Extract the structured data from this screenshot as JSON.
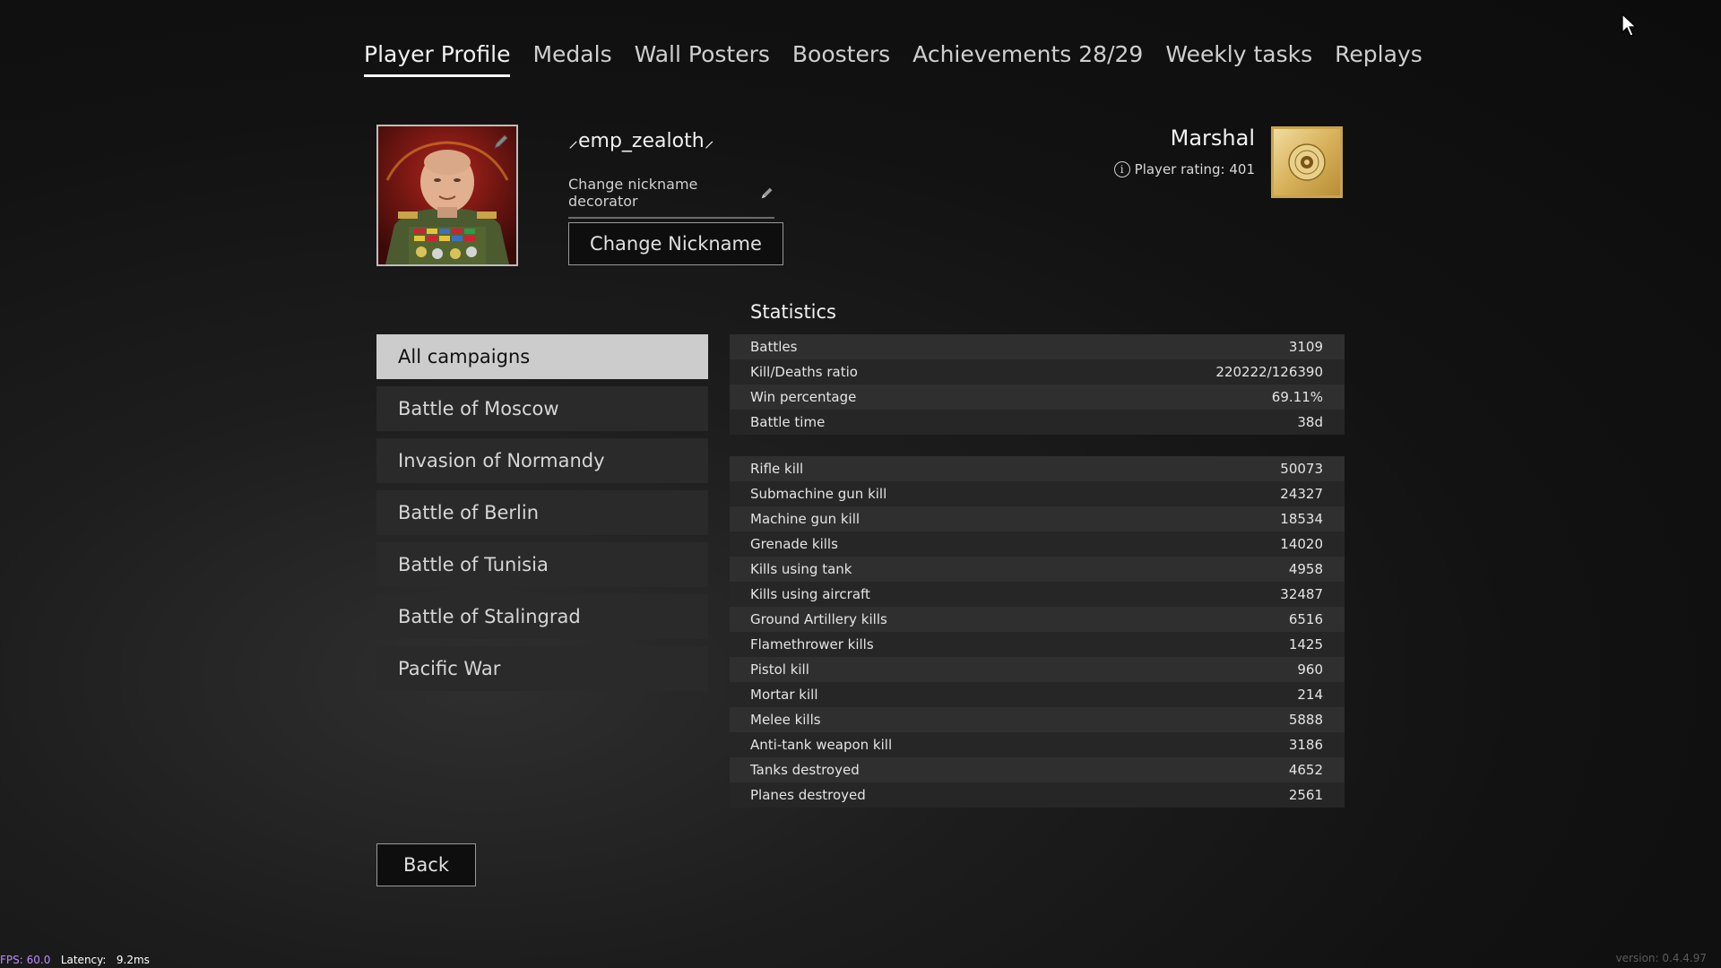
{
  "tabs": [
    {
      "label": "Player Profile",
      "active": true
    },
    {
      "label": "Medals"
    },
    {
      "label": "Wall Posters"
    },
    {
      "label": "Boosters"
    },
    {
      "label": "Achievements 28/29"
    },
    {
      "label": "Weekly tasks"
    },
    {
      "label": "Replays"
    }
  ],
  "profile": {
    "nickname": "⸝emp_zealoth⸝",
    "decorator_label": "Change nickname decorator",
    "change_nickname_label": "Change Nickname",
    "rank": "Marshal",
    "rating_label": "Player rating: 401"
  },
  "campaigns": [
    {
      "label": "All campaigns",
      "active": true
    },
    {
      "label": "Battle of Moscow"
    },
    {
      "label": "Invasion of Normandy"
    },
    {
      "label": "Battle of Berlin"
    },
    {
      "label": "Battle of Tunisia"
    },
    {
      "label": "Battle of Stalingrad"
    },
    {
      "label": "Pacific War"
    }
  ],
  "statistics": {
    "title": "Statistics",
    "general": [
      {
        "label": "Battles",
        "value": "3109"
      },
      {
        "label": "Kill/Deaths ratio",
        "value": "220222/126390"
      },
      {
        "label": "Win percentage",
        "value": "69.11%"
      },
      {
        "label": "Battle time",
        "value": "38d"
      }
    ],
    "kills": [
      {
        "label": "Rifle kill",
        "value": "50073"
      },
      {
        "label": "Submachine gun kill",
        "value": "24327"
      },
      {
        "label": "Machine gun kill",
        "value": "18534"
      },
      {
        "label": "Grenade kills",
        "value": "14020"
      },
      {
        "label": "Kills using tank",
        "value": "4958"
      },
      {
        "label": "Kills using aircraft",
        "value": "32487"
      },
      {
        "label": "Ground Artillery kills",
        "value": "6516"
      },
      {
        "label": "Flamethrower kills",
        "value": "1425"
      },
      {
        "label": "Pistol kill",
        "value": "960"
      },
      {
        "label": "Mortar kill",
        "value": "214"
      },
      {
        "label": "Melee kills",
        "value": "5888"
      },
      {
        "label": "Anti-tank weapon kill",
        "value": "3186"
      },
      {
        "label": "Tanks destroyed",
        "value": "4652"
      },
      {
        "label": "Planes destroyed",
        "value": "2561"
      }
    ]
  },
  "back_label": "Back",
  "footer": {
    "fps_label": "FPS:",
    "fps_value": "60.0",
    "latency_label": "Latency:",
    "latency_value": "9.2ms",
    "version": "version: 0.4.4.97"
  },
  "colors": {
    "accent_gold": "#c9a44b",
    "active_campaign_bg": "#cccccc",
    "row_bg": "#2f2f2f"
  }
}
